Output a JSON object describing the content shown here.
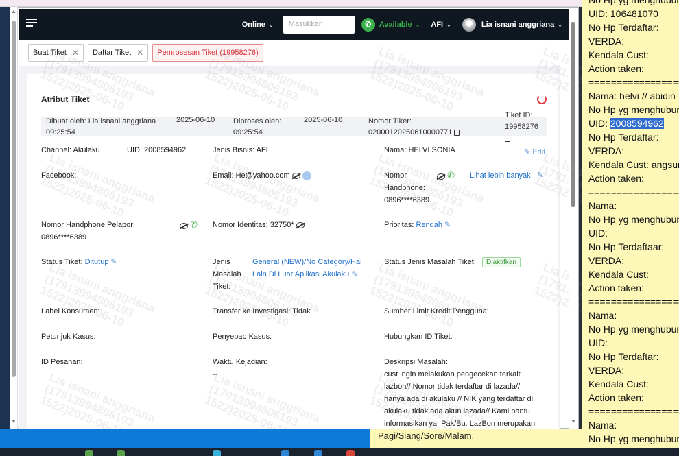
{
  "topbar": {
    "status": "Online",
    "search_placeholder": "Masukkan",
    "availability": "Available",
    "team": "AFI",
    "user_name": "Lia isnani anggriana"
  },
  "tabs": [
    {
      "label": "Buat Tiket"
    },
    {
      "label": "Daftar Tiket"
    },
    {
      "label": "Pemrosesan Tiket (19958276)"
    }
  ],
  "card": {
    "title": "Atribut Tiket",
    "meta": {
      "dibuat_oleh": "Dibuat oleh: Lia isnani anggriana",
      "dibuat_date": "2025-06-10",
      "dibuat_time": "09:25:54",
      "diproses_oleh": "Diproses oleh:",
      "diproses_date": "2025-06-10",
      "diproses_time": "09:25:54",
      "nomor_tiker_label": "Nomor Tiker:",
      "nomor_tiker_value": "02000120250610000771",
      "tiket_id_label": "Tiket ID:",
      "tiket_id_value": "19958276"
    },
    "channel": "Channel: Akulaku",
    "uid": "UID: 2008594962",
    "jenis_bisnis": "Jenis Bisnis: AFI",
    "nama": "Nama: HELVI SONIA",
    "edit": "Edit",
    "facebook": "Facebook:",
    "email": "Email: He@yahoo.com",
    "nomor_hp_label_1": "Nomor",
    "nomor_hp_label_2": "Handphone:",
    "nomor_hp_value": "0896****6389",
    "lihat_lebih": "Lihat lebih banyak",
    "hp_pelapor_label": "Nomor Handphone Pelapor:",
    "hp_pelapor_value": "0896****6389",
    "nomor_identitas": "Nomor Identitas: 32750*",
    "prioritas_label": "Prioritas:",
    "prioritas_value": "Rendah",
    "status_tiket_label": "Status Tiket:",
    "status_tiket_value": "Ditutup",
    "jenis_masalah_1": "Jenis",
    "jenis_masalah_2": "Masalah",
    "jenis_masalah_3": "Tiket:",
    "jenis_masalah_value_1": "General (NEW)/No Category/Hal",
    "jenis_masalah_value_2": "Lain Di Luar Aplikasi Akulaku",
    "status_jenis_label": "Status Jenis Masalah Tiket:",
    "status_jenis_badge": "Diaktifkan",
    "label_konsumen": "Label Konsumen:",
    "transfer_investigasi": "Transfer ke Investigasi: Tidak",
    "sumber_limit": "Sumber Limit Kredit Pengguna:",
    "petunjuk_kasus": "Petunjuk Kasus:",
    "penyebab_kasus": "Penyebab Kasus:",
    "hubungkan_id": "Hubungkan ID Tiket:",
    "id_pesanan": "ID Pesanan:",
    "waktu_kejadian": "Waktu Kejadian:",
    "waktu_value": "--",
    "deskripsi_label": "Deskripsi Masalah:",
    "deskripsi_lines": [
      "cust ingin melakukan pengecekan terkait",
      "lazbon// Nomor tidak terdaftar di lazada//",
      "hanya ada di akulaku // NIK yang terdaftar di",
      "akulaku tidak ada akun lazada// Kami bantu",
      "informasikan ya, Pak/Bu. LazBon merupakan"
    ]
  },
  "watermark": "Lia isnani anggriana\n(17913994806193\n1522)2025-06-10",
  "bottom_note": "Pagi/Siang/Sore/Malam.",
  "notepad": {
    "lines": [
      "No Hp yg menghubun",
      "UID: 106481070",
      "No Hp Terdaftar:",
      "VERDA:",
      "Kendala Cust:",
      "Action taken:",
      "==================",
      "Nama: helvi // abidin",
      "No Hp yg menghubun",
      "UID: ",
      "No Hp Terdaftar:",
      "VERDA:",
      "Kendala Cust: angsura",
      "Action taken:",
      "==================",
      "Nama:",
      "No Hp yg menghubun",
      "UID:",
      "No Hp Terdaftaar:",
      "VERDA:",
      "Kendala Cust:",
      "Action taken:",
      "==================",
      "Nama:",
      "No Hp yg menghubun",
      "UID:",
      "No Hp Terdaftar:",
      "VERDA:",
      "Kendala Cust:",
      "Action taken:",
      "==================",
      "Nama:",
      "No Hp yg menghubun"
    ],
    "highlighted_uid": "2008594962"
  }
}
